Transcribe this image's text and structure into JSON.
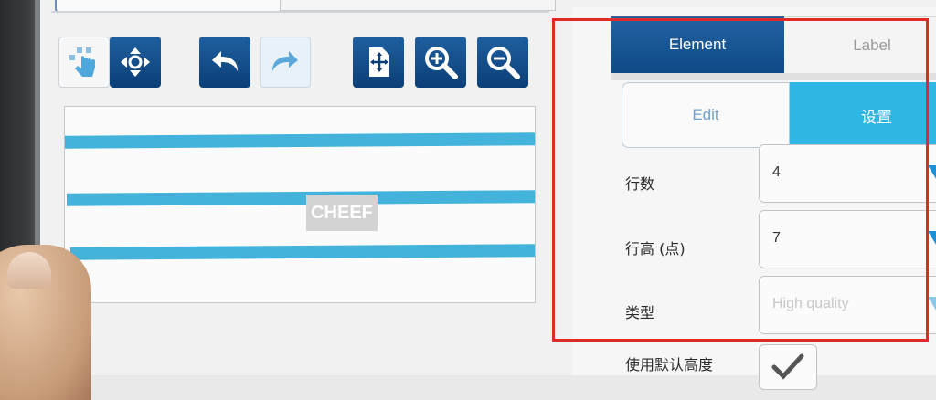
{
  "toolbar": {
    "icons": [
      "touch-select-icon",
      "move-arrows-icon",
      "undo-icon",
      "redo-icon",
      "page-center-icon",
      "zoom-in-icon",
      "zoom-out-icon"
    ]
  },
  "canvas": {
    "preview_text": "CHEEF",
    "line_count": 3,
    "line_color": "#43b3dc"
  },
  "panel": {
    "tabs": [
      {
        "label": "Element",
        "active": true
      },
      {
        "label": "Label",
        "active": false
      }
    ],
    "segments": [
      {
        "label": "Edit",
        "active": false
      },
      {
        "label": "设置",
        "active": true
      }
    ],
    "fields": [
      {
        "label": "行数",
        "value": "4"
      },
      {
        "label": "行高 (点)",
        "value": "7"
      },
      {
        "label": "类型",
        "value": "High quality",
        "disabled": true
      }
    ],
    "default_height": {
      "label": "使用默认高度",
      "checked": true
    }
  },
  "colors": {
    "accent_dark": "#0e4a86",
    "accent_light": "#2fb7e4",
    "highlight_border": "#e02a25"
  }
}
